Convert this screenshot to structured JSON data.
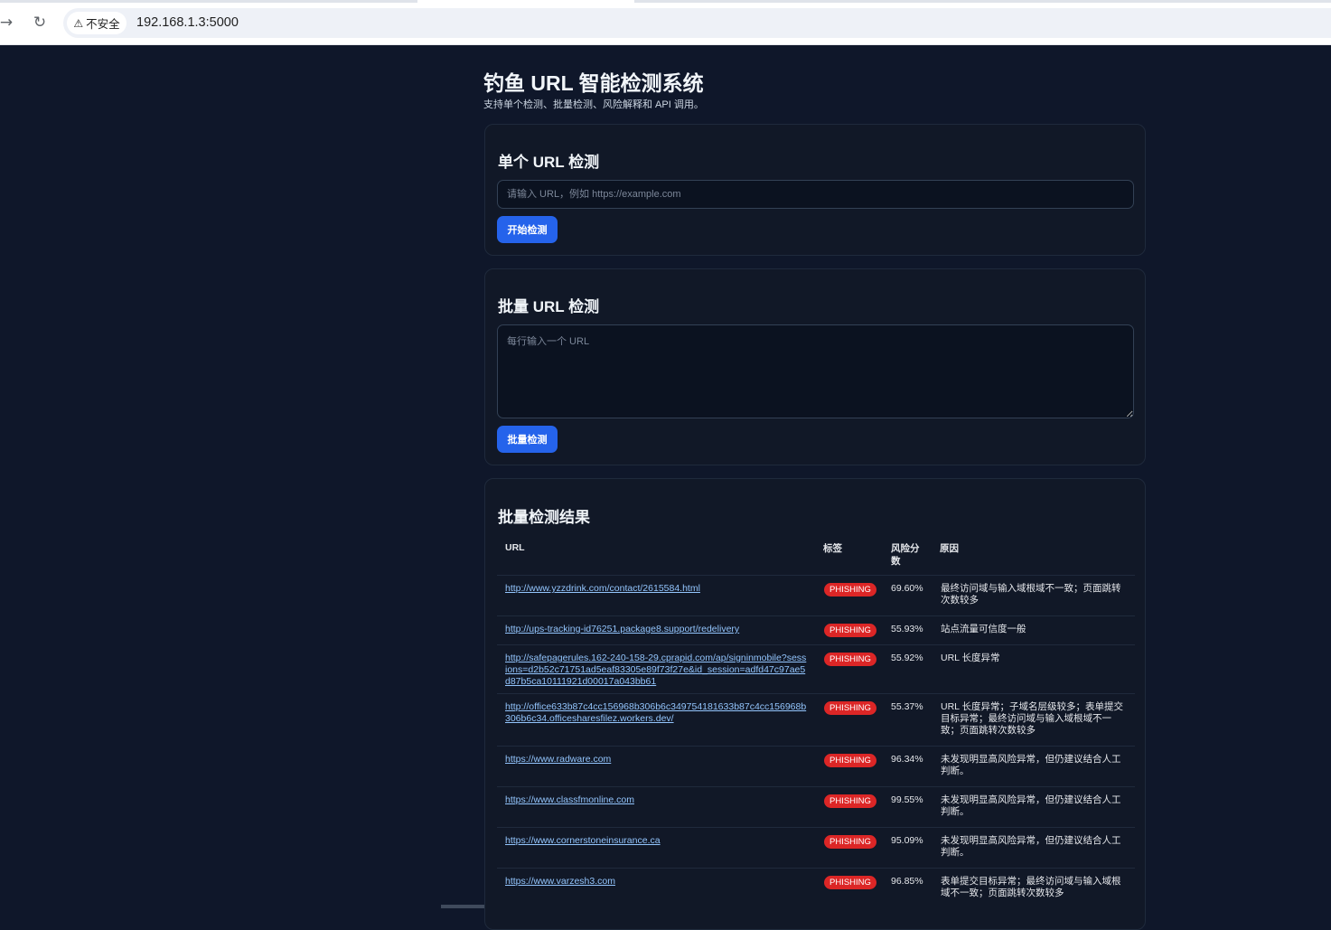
{
  "browser": {
    "back_icon": "→",
    "reload_icon": "↻",
    "security_label": "不安全",
    "address": "192.168.1.3:5000"
  },
  "page": {
    "title": "钓鱼 URL 智能检测系统",
    "subtitle": "支持单个检测、批量检测、风险解释和 API 调用。"
  },
  "single": {
    "title": "单个 URL 检测",
    "placeholder": "请输入 URL，例如 https://example.com",
    "value": "",
    "button": "开始检测"
  },
  "batch": {
    "title": "批量 URL 检测",
    "placeholder": "每行输入一个 URL",
    "value": "",
    "button": "批量检测"
  },
  "results": {
    "title": "批量检测结果",
    "headers": {
      "url": "URL",
      "label": "标签",
      "score": "风险分数",
      "reason": "原因"
    },
    "rows": [
      {
        "url": "http://www.yzzdrink.com/contact/2615584.html",
        "label": "PHISHING",
        "score": "69.60%",
        "reason": "最终访问域与输入域根域不一致；页面跳转次数较多"
      },
      {
        "url": "http://ups-tracking-id76251.package8.support/redelivery",
        "label": "PHISHING",
        "score": "55.93%",
        "reason": "站点流量可信度一般"
      },
      {
        "url": "http://safepagerules.162-240-158-29.cprapid.com/ap/signinmobile?sessions=d2b52c71751ad5eaf83305e89f73f27e&id_session=adfd47c97ae5d87b5ca10111921d00017a043bb61",
        "label": "PHISHING",
        "score": "55.92%",
        "reason": "URL 长度异常"
      },
      {
        "url": "http://office633b87c4cc156968b306b6c349754181633b87c4cc156968b306b6c34.officesharesfilez.workers.dev/",
        "label": "PHISHING",
        "score": "55.37%",
        "reason": "URL 长度异常；子域名层级较多；表单提交目标异常；最终访问域与输入域根域不一致；页面跳转次数较多"
      },
      {
        "url": "https://www.radware.com",
        "label": "PHISHING",
        "score": "96.34%",
        "reason": "未发现明显高风险异常，但仍建议结合人工判断。"
      },
      {
        "url": "https://www.classfmonline.com",
        "label": "PHISHING",
        "score": "99.55%",
        "reason": "未发现明显高风险异常，但仍建议结合人工判断。"
      },
      {
        "url": "https://www.cornerstoneinsurance.ca",
        "label": "PHISHING",
        "score": "95.09%",
        "reason": "未发现明显高风险异常，但仍建议结合人工判断。"
      },
      {
        "url": "https://www.varzesh3.com",
        "label": "PHISHING",
        "score": "96.85%",
        "reason": "表单提交目标异常；最终访问域与输入域根域不一致；页面跳转次数较多"
      }
    ]
  },
  "colors": {
    "background": "#0f172a",
    "card": "#111827",
    "accent": "#2563eb",
    "phishing": "#dc2626",
    "link": "#93c5fd"
  }
}
